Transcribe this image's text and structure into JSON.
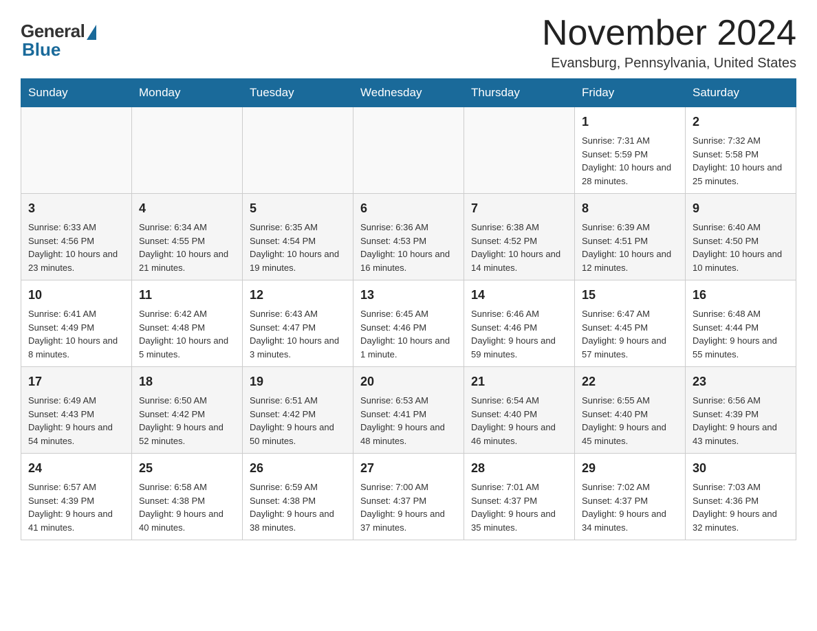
{
  "logo": {
    "general": "General",
    "blue": "Blue"
  },
  "header": {
    "title": "November 2024",
    "location": "Evansburg, Pennsylvania, United States"
  },
  "weekdays": [
    "Sunday",
    "Monday",
    "Tuesday",
    "Wednesday",
    "Thursday",
    "Friday",
    "Saturday"
  ],
  "weeks": [
    [
      {
        "day": "",
        "sunrise": "",
        "sunset": "",
        "daylight": ""
      },
      {
        "day": "",
        "sunrise": "",
        "sunset": "",
        "daylight": ""
      },
      {
        "day": "",
        "sunrise": "",
        "sunset": "",
        "daylight": ""
      },
      {
        "day": "",
        "sunrise": "",
        "sunset": "",
        "daylight": ""
      },
      {
        "day": "",
        "sunrise": "",
        "sunset": "",
        "daylight": ""
      },
      {
        "day": "1",
        "sunrise": "Sunrise: 7:31 AM",
        "sunset": "Sunset: 5:59 PM",
        "daylight": "Daylight: 10 hours and 28 minutes."
      },
      {
        "day": "2",
        "sunrise": "Sunrise: 7:32 AM",
        "sunset": "Sunset: 5:58 PM",
        "daylight": "Daylight: 10 hours and 25 minutes."
      }
    ],
    [
      {
        "day": "3",
        "sunrise": "Sunrise: 6:33 AM",
        "sunset": "Sunset: 4:56 PM",
        "daylight": "Daylight: 10 hours and 23 minutes."
      },
      {
        "day": "4",
        "sunrise": "Sunrise: 6:34 AM",
        "sunset": "Sunset: 4:55 PM",
        "daylight": "Daylight: 10 hours and 21 minutes."
      },
      {
        "day": "5",
        "sunrise": "Sunrise: 6:35 AM",
        "sunset": "Sunset: 4:54 PM",
        "daylight": "Daylight: 10 hours and 19 minutes."
      },
      {
        "day": "6",
        "sunrise": "Sunrise: 6:36 AM",
        "sunset": "Sunset: 4:53 PM",
        "daylight": "Daylight: 10 hours and 16 minutes."
      },
      {
        "day": "7",
        "sunrise": "Sunrise: 6:38 AM",
        "sunset": "Sunset: 4:52 PM",
        "daylight": "Daylight: 10 hours and 14 minutes."
      },
      {
        "day": "8",
        "sunrise": "Sunrise: 6:39 AM",
        "sunset": "Sunset: 4:51 PM",
        "daylight": "Daylight: 10 hours and 12 minutes."
      },
      {
        "day": "9",
        "sunrise": "Sunrise: 6:40 AM",
        "sunset": "Sunset: 4:50 PM",
        "daylight": "Daylight: 10 hours and 10 minutes."
      }
    ],
    [
      {
        "day": "10",
        "sunrise": "Sunrise: 6:41 AM",
        "sunset": "Sunset: 4:49 PM",
        "daylight": "Daylight: 10 hours and 8 minutes."
      },
      {
        "day": "11",
        "sunrise": "Sunrise: 6:42 AM",
        "sunset": "Sunset: 4:48 PM",
        "daylight": "Daylight: 10 hours and 5 minutes."
      },
      {
        "day": "12",
        "sunrise": "Sunrise: 6:43 AM",
        "sunset": "Sunset: 4:47 PM",
        "daylight": "Daylight: 10 hours and 3 minutes."
      },
      {
        "day": "13",
        "sunrise": "Sunrise: 6:45 AM",
        "sunset": "Sunset: 4:46 PM",
        "daylight": "Daylight: 10 hours and 1 minute."
      },
      {
        "day": "14",
        "sunrise": "Sunrise: 6:46 AM",
        "sunset": "Sunset: 4:46 PM",
        "daylight": "Daylight: 9 hours and 59 minutes."
      },
      {
        "day": "15",
        "sunrise": "Sunrise: 6:47 AM",
        "sunset": "Sunset: 4:45 PM",
        "daylight": "Daylight: 9 hours and 57 minutes."
      },
      {
        "day": "16",
        "sunrise": "Sunrise: 6:48 AM",
        "sunset": "Sunset: 4:44 PM",
        "daylight": "Daylight: 9 hours and 55 minutes."
      }
    ],
    [
      {
        "day": "17",
        "sunrise": "Sunrise: 6:49 AM",
        "sunset": "Sunset: 4:43 PM",
        "daylight": "Daylight: 9 hours and 54 minutes."
      },
      {
        "day": "18",
        "sunrise": "Sunrise: 6:50 AM",
        "sunset": "Sunset: 4:42 PM",
        "daylight": "Daylight: 9 hours and 52 minutes."
      },
      {
        "day": "19",
        "sunrise": "Sunrise: 6:51 AM",
        "sunset": "Sunset: 4:42 PM",
        "daylight": "Daylight: 9 hours and 50 minutes."
      },
      {
        "day": "20",
        "sunrise": "Sunrise: 6:53 AM",
        "sunset": "Sunset: 4:41 PM",
        "daylight": "Daylight: 9 hours and 48 minutes."
      },
      {
        "day": "21",
        "sunrise": "Sunrise: 6:54 AM",
        "sunset": "Sunset: 4:40 PM",
        "daylight": "Daylight: 9 hours and 46 minutes."
      },
      {
        "day": "22",
        "sunrise": "Sunrise: 6:55 AM",
        "sunset": "Sunset: 4:40 PM",
        "daylight": "Daylight: 9 hours and 45 minutes."
      },
      {
        "day": "23",
        "sunrise": "Sunrise: 6:56 AM",
        "sunset": "Sunset: 4:39 PM",
        "daylight": "Daylight: 9 hours and 43 minutes."
      }
    ],
    [
      {
        "day": "24",
        "sunrise": "Sunrise: 6:57 AM",
        "sunset": "Sunset: 4:39 PM",
        "daylight": "Daylight: 9 hours and 41 minutes."
      },
      {
        "day": "25",
        "sunrise": "Sunrise: 6:58 AM",
        "sunset": "Sunset: 4:38 PM",
        "daylight": "Daylight: 9 hours and 40 minutes."
      },
      {
        "day": "26",
        "sunrise": "Sunrise: 6:59 AM",
        "sunset": "Sunset: 4:38 PM",
        "daylight": "Daylight: 9 hours and 38 minutes."
      },
      {
        "day": "27",
        "sunrise": "Sunrise: 7:00 AM",
        "sunset": "Sunset: 4:37 PM",
        "daylight": "Daylight: 9 hours and 37 minutes."
      },
      {
        "day": "28",
        "sunrise": "Sunrise: 7:01 AM",
        "sunset": "Sunset: 4:37 PM",
        "daylight": "Daylight: 9 hours and 35 minutes."
      },
      {
        "day": "29",
        "sunrise": "Sunrise: 7:02 AM",
        "sunset": "Sunset: 4:37 PM",
        "daylight": "Daylight: 9 hours and 34 minutes."
      },
      {
        "day": "30",
        "sunrise": "Sunrise: 7:03 AM",
        "sunset": "Sunset: 4:36 PM",
        "daylight": "Daylight: 9 hours and 32 minutes."
      }
    ]
  ]
}
